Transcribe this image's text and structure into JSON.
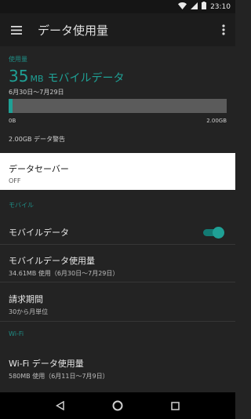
{
  "status_bar": {
    "time": "23:10",
    "icons": [
      "wifi-icon",
      "signal-icon",
      "battery-icon"
    ]
  },
  "app_bar": {
    "title": "データ使用量",
    "menu_icon": "hamburger-menu-icon",
    "more_icon": "more-vert-icon"
  },
  "usage": {
    "section_label": "使用量",
    "amount": "35",
    "unit": "MB",
    "label": "モバイルデータ",
    "date_range": "6月30日〜7月29日",
    "bar_min": "0B",
    "bar_max": "2.00GB",
    "fill_fraction": 0.017,
    "warning": "2.00GB データ警告"
  },
  "data_saver": {
    "title": "データセーバー",
    "status": "OFF"
  },
  "mobile_section": {
    "header": "モバイル",
    "mobile_data": {
      "title": "モバイルデータ",
      "enabled": true
    },
    "mobile_usage": {
      "title": "モバイルデータ使用量",
      "subtitle": "34.61MB 使用（6月30日〜7月29日）"
    },
    "billing": {
      "title": "請求期間",
      "subtitle": "30から月単位"
    }
  },
  "wifi_section": {
    "header": "Wi-Fi",
    "wifi_usage": {
      "title": "Wi-Fi データ使用量",
      "subtitle": "580MB 使用（6月11日〜7月9日）"
    }
  },
  "colors": {
    "accent": "#1fa095",
    "background": "#232323",
    "highlight": "#ffffff"
  }
}
